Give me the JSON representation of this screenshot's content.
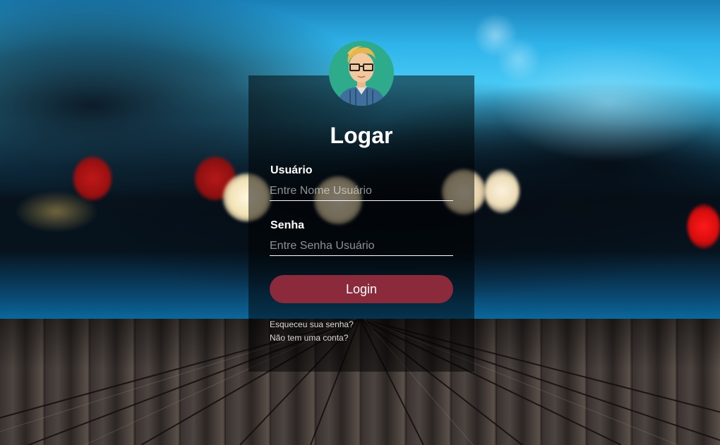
{
  "login": {
    "title": "Logar",
    "username_label": "Usuário",
    "username_placeholder": "Entre Nome Usuário",
    "username_value": "",
    "password_label": "Senha",
    "password_placeholder": "Entre Senha Usuário",
    "password_value": "",
    "submit_label": "Login",
    "forgot_password_link": "Esqueceu sua senha?",
    "signup_link": "Não tem uma conta?"
  },
  "colors": {
    "button": "#8a2a3b",
    "avatar_bg": "#2dab8b",
    "card_overlay": "rgba(0,0,0,0.5)"
  },
  "icons": {
    "avatar": "user-avatar-icon"
  }
}
